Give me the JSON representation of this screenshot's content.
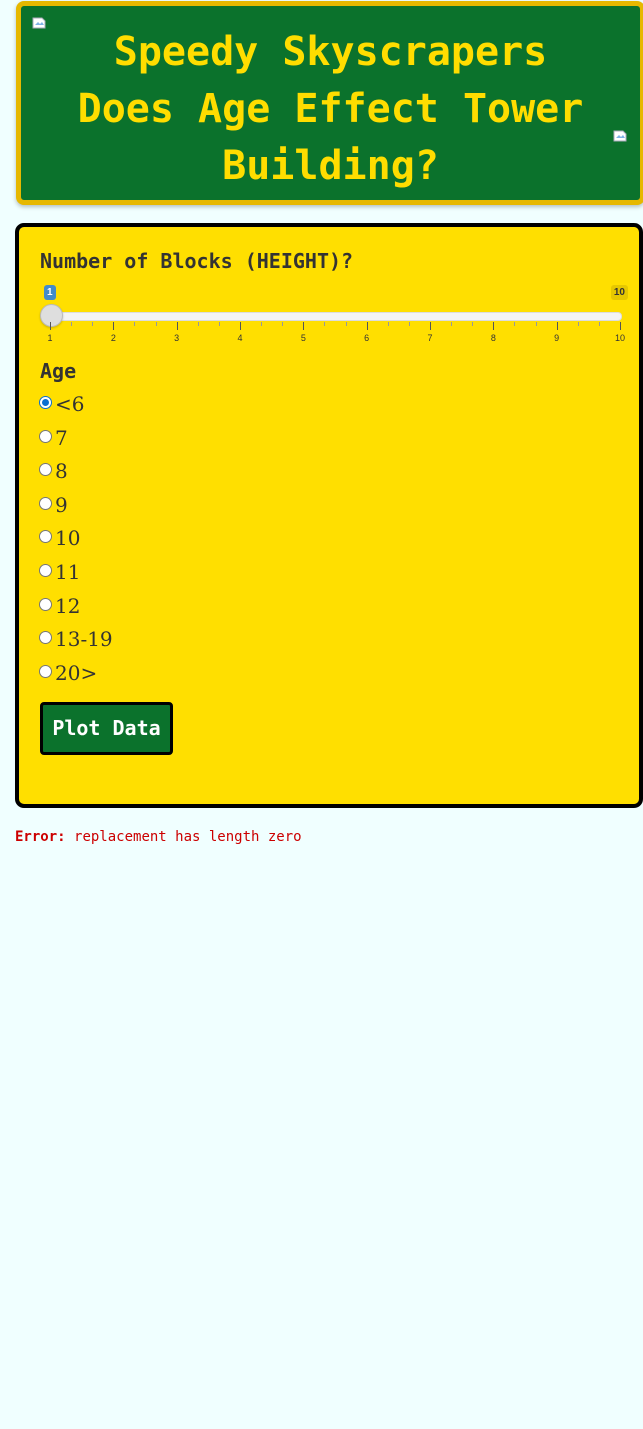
{
  "header": {
    "title_lines": [
      "Speedy Skyscrapers",
      "Does Age Effect Tower",
      "Building?"
    ],
    "left_image_icon": "broken-image-icon",
    "right_image_icon": "broken-image-icon"
  },
  "slider": {
    "label": "Number of Blocks (HEIGHT)?",
    "min": 1,
    "max": 10,
    "value": 1,
    "min_badge": "1",
    "max_badge": "10",
    "tick_labels": [
      "1",
      "2",
      "3",
      "4",
      "5",
      "6",
      "7",
      "8",
      "9",
      "10"
    ]
  },
  "age": {
    "label": "Age",
    "options": [
      "<6",
      "7",
      "8",
      "9",
      "10",
      "11",
      "12",
      "13-19",
      "20>"
    ],
    "selected_index": 0
  },
  "plot_button": {
    "label": "Plot Data"
  },
  "error": {
    "prefix": "Error:",
    "message": "replacement has length zero"
  },
  "colors": {
    "background": "#f0ffff",
    "header_green": "#0b722c",
    "title_yellow": "#ffdd00",
    "panel_yellow": "#ffdf00",
    "error_red": "#cc0000",
    "slider_blue": "#428bca"
  }
}
